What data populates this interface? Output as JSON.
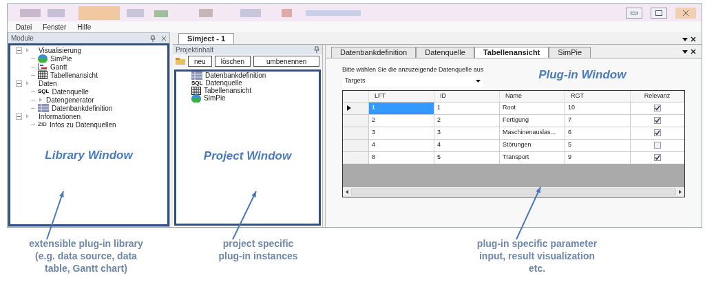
{
  "menu": [
    "Datei",
    "Fenster",
    "Hilfe"
  ],
  "library_panel": {
    "title": "Module",
    "tree": [
      {
        "label": "Visualisierung",
        "expanded": true,
        "children": [
          {
            "label": "SimPie",
            "kind": "pie"
          },
          {
            "label": "Gantt",
            "kind": "gantt"
          },
          {
            "label": "Tabellenansicht",
            "kind": "grid"
          }
        ]
      },
      {
        "label": "Daten",
        "expanded": true,
        "children": [
          {
            "label": "Datenquelle",
            "kind": "sql",
            "icon_text": "SQL"
          },
          {
            "label": "Datengenerator",
            "kind": "play"
          },
          {
            "label": "Datenbankdefinition",
            "kind": "db"
          }
        ]
      },
      {
        "label": "Informationen",
        "expanded": true,
        "children": [
          {
            "label": "Infos zu Datenquellen",
            "kind": "text",
            "icon_text": "ZID"
          }
        ]
      }
    ],
    "annotation": "Library Window"
  },
  "document_tab": "Simject - 1",
  "project_panel": {
    "title": "Projektinhalt",
    "buttons": [
      "neu",
      "löschen",
      "umbenennen"
    ],
    "items": [
      {
        "label": "Datenbankdefinition",
        "kind": "db"
      },
      {
        "label": "Datenquelle",
        "kind": "sql",
        "icon_text": "SQL"
      },
      {
        "label": "Tabellenansicht",
        "kind": "grid"
      },
      {
        "label": "SimPie",
        "kind": "pie"
      }
    ],
    "annotation": "Project Window"
  },
  "plugin_panel": {
    "tabs": [
      {
        "label": "Datenbankdefinition",
        "selected": false
      },
      {
        "label": "Datenquelle",
        "selected": false
      },
      {
        "label": "Tabellenansicht",
        "selected": true
      },
      {
        "label": "SimPie",
        "selected": false
      }
    ],
    "prompt": "Bitte wählen Sie die anzuzeigende Datenquelle aus",
    "source": "Targets",
    "annotation": "Plug-in Window",
    "table": {
      "columns": [
        "LFT",
        "ID",
        "Name",
        "RGT",
        "Relevanz"
      ],
      "rows": [
        {
          "cells": [
            "1",
            "1",
            "Root",
            "10"
          ],
          "relevant": true,
          "selected": true
        },
        {
          "cells": [
            "2",
            "2",
            "Fertigung",
            "7"
          ],
          "relevant": true,
          "selected": false
        },
        {
          "cells": [
            "3",
            "3",
            "Maschinenauslas...",
            "6"
          ],
          "relevant": true,
          "selected": false
        },
        {
          "cells": [
            "4",
            "4",
            "Störungen",
            "5"
          ],
          "relevant": false,
          "selected": false
        },
        {
          "cells": [
            "8",
            "5",
            "Transport",
            "9"
          ],
          "relevant": true,
          "selected": false
        }
      ]
    }
  },
  "captions": [
    {
      "lines": [
        "extensible plug-in library",
        "(e.g. data source, data",
        "table, Gantt chart)"
      ]
    },
    {
      "lines": [
        "project specific",
        "plug-in instances"
      ]
    },
    {
      "lines": [
        "plug-in specific parameter",
        "input, result visualization",
        "etc."
      ]
    }
  ]
}
